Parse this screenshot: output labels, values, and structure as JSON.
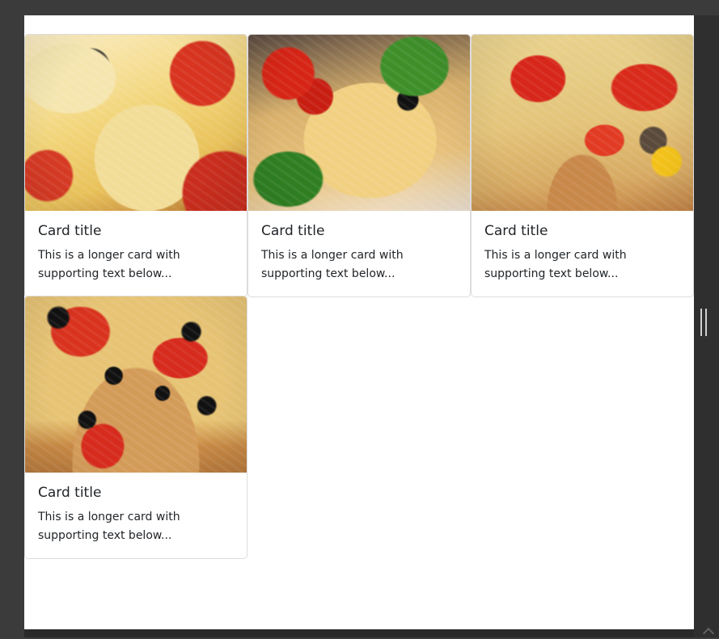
{
  "cards": [
    {
      "title": "Card title",
      "text": "This is a longer card with supporting text below...",
      "image_icon": "pizza-image"
    },
    {
      "title": "Card title",
      "text": "This is a longer card with supporting text below...",
      "image_icon": "pizza-image"
    },
    {
      "title": "Card title",
      "text": "This is a longer card with supporting text below...",
      "image_icon": "pizza-image"
    },
    {
      "title": "Card title",
      "text": "This is a longer card with supporting text below...",
      "image_icon": "pizza-image"
    }
  ],
  "colors": {
    "background": "#3b3b3b",
    "viewport": "#ffffff",
    "card_border": "#dcdcdc",
    "text": "#212529"
  }
}
